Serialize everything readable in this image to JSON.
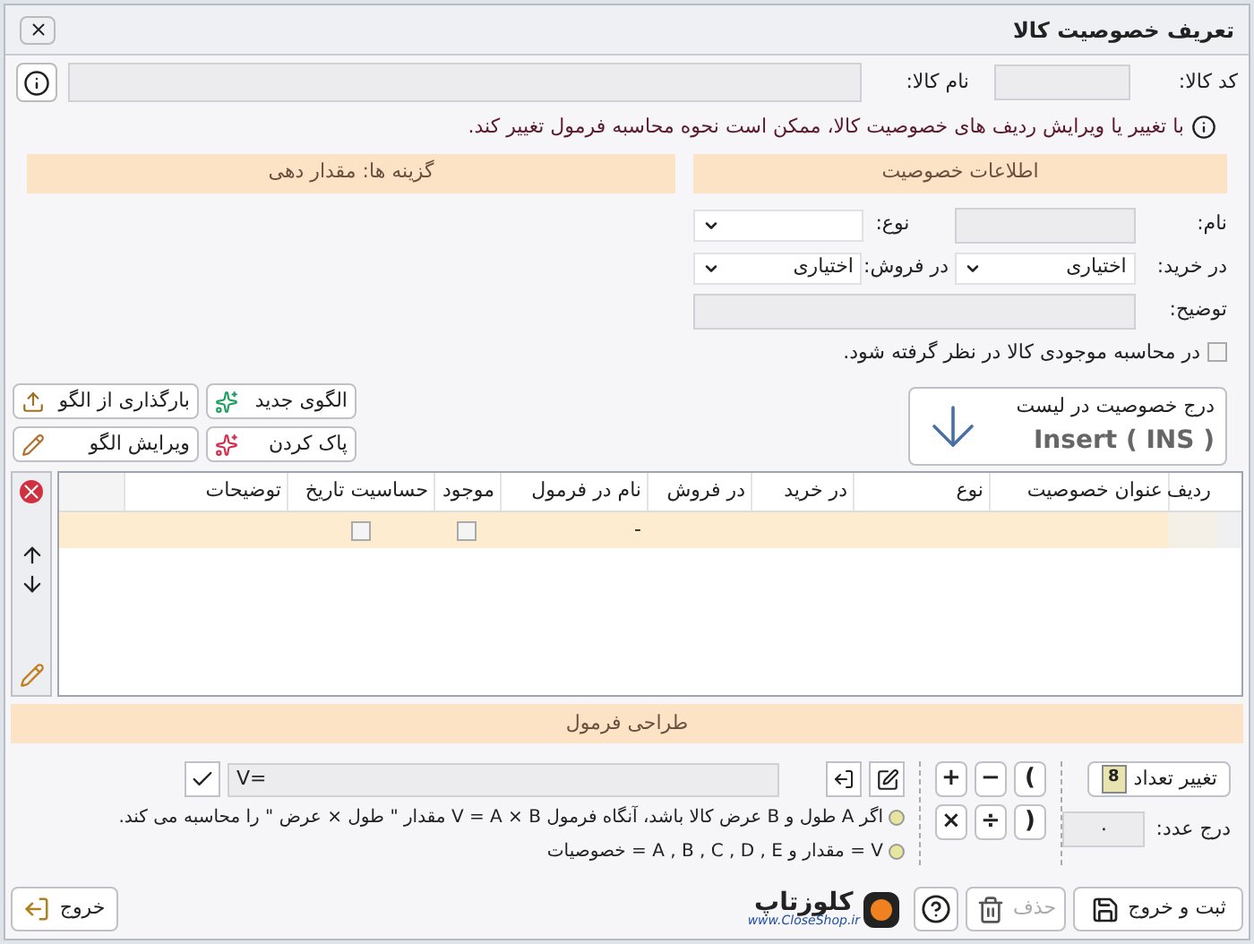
{
  "window": {
    "title": "تعریف خصوصیت کالا"
  },
  "header": {
    "code_label": "کد کالا:",
    "name_label": "نام کالا:"
  },
  "notice": "با تغییر یا ویرایش ردیف های خصوصیت کالا، ممکن است نحوه محاسبه فرمول تغییر کند.",
  "sections": {
    "info": "اطلاعات خصوصیت",
    "options": "گزینه ها: مقدار دهی",
    "formula": "طراحی فرمول"
  },
  "form": {
    "name_label": "نام:",
    "type_label": "نوع:",
    "purchase_label": "در خرید:",
    "purchase_value": "اختیاری",
    "sale_label": "در فروش:",
    "sale_value": "اختیاری",
    "description_label": "توضیح:",
    "stock_checkbox": {
      "label": "در محاسبه موجودی کالا در نظر گرفته شود.",
      "checked": false
    }
  },
  "insert_button": {
    "label": "درج خصوصیت در لیست",
    "shortcut": "Insert ( INS )"
  },
  "template_buttons": [
    {
      "label": "الگوی جدید",
      "kind": "new"
    },
    {
      "label": "بارگذاری از الگو",
      "kind": "load"
    },
    {
      "label": "پاک کردن",
      "kind": "clear"
    },
    {
      "label": "ویرایش الگو",
      "kind": "edit"
    }
  ],
  "table": {
    "columns": [
      "ردیف",
      "عنوان خصوصیت",
      "نوع",
      "در خرید",
      "در فروش",
      "نام در فرمول",
      "موجود",
      "حساسیت تاریخ",
      "توضیحات"
    ],
    "rows": [
      {
        "formula_name": "-",
        "in_stock": false,
        "date_sensitive": false,
        "selected": true
      }
    ]
  },
  "formula": {
    "change_count_button": "تغییر تعداد",
    "count_badge": "8",
    "number_label": "درج عدد:",
    "number_value": "٠",
    "operators": [
      ")",
      "−",
      "+",
      "(",
      "÷",
      "×"
    ],
    "expression": "V=",
    "hints": [
      "اگر A طول و B عرض کالا باشد، آنگاه فرمول V = A × B مقدار \" طول × عرض \" را محاسبه می کند.",
      "V = مقدار و A , B , C , D , E = خصوصیات"
    ]
  },
  "footer": {
    "save_exit": "ثبت و خروج",
    "delete": {
      "label": "حذف",
      "disabled": true
    },
    "logo_text": "کلوزتاپ",
    "logo_url": "www.CloseShop.ir",
    "exit": "خروج"
  }
}
